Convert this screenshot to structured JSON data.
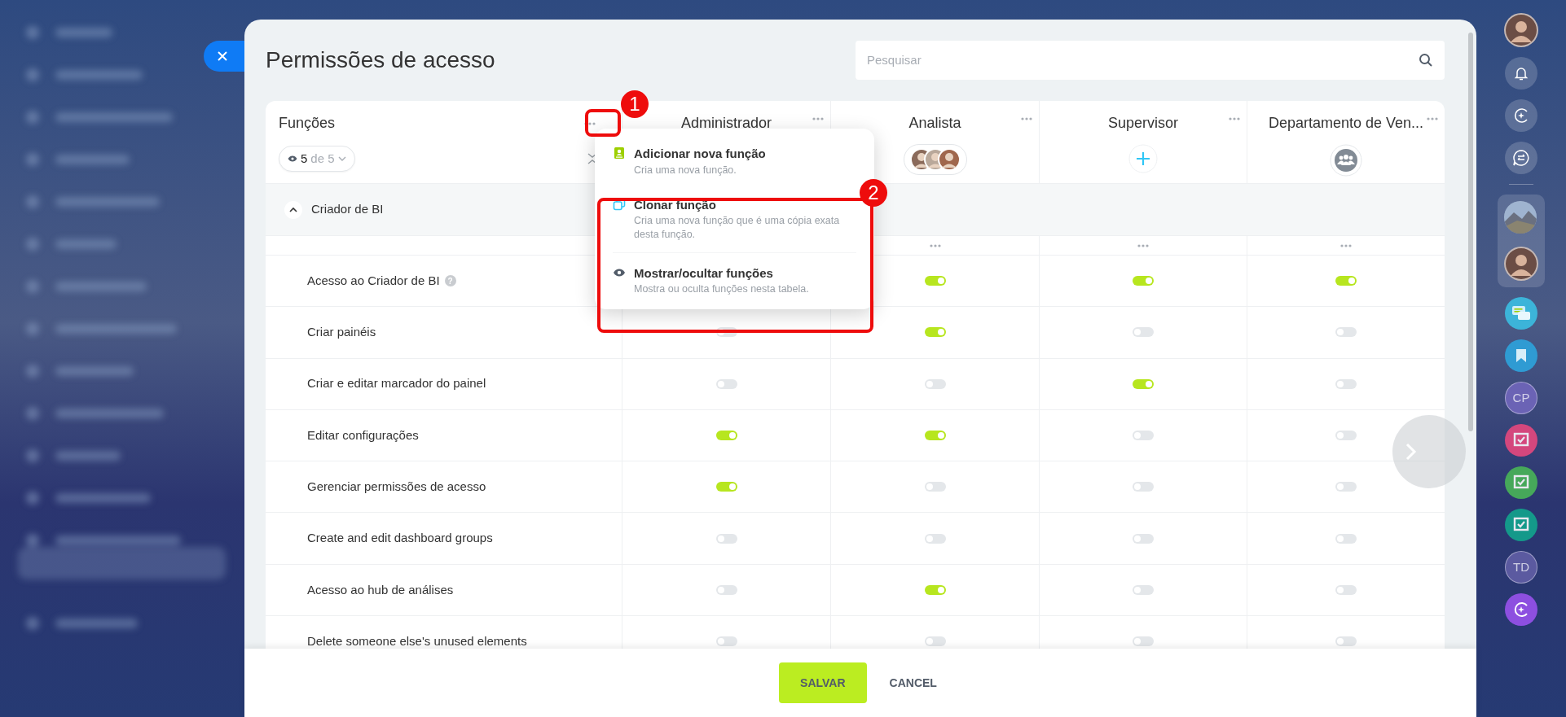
{
  "title": "Permissões de acesso",
  "search": {
    "placeholder": "Pesquisar"
  },
  "roles_header": {
    "label": "Funções",
    "visible_count": "5",
    "visible_total": "de 5"
  },
  "roles": [
    {
      "name": "Administrador"
    },
    {
      "name": "Analista",
      "members": {
        "kind": "avatars"
      }
    },
    {
      "name": "Supervisor",
      "members": {
        "kind": "add"
      }
    },
    {
      "name": "Departamento de Ven...",
      "members": {
        "kind": "department"
      }
    }
  ],
  "sections": [
    {
      "title": "Criador de BI",
      "expanded": true,
      "rows": [
        {
          "label": "Acesso ao Criador de BI",
          "help": "?",
          "toggles": [
            true,
            true,
            true
          ]
        },
        {
          "label": "Criar painéis",
          "toggles": [
            false,
            true,
            false,
            false
          ]
        },
        {
          "label": "Criar e editar marcador do painel",
          "toggles": [
            false,
            false,
            true,
            false
          ]
        },
        {
          "label": "Editar configurações",
          "toggles": [
            true,
            true,
            false,
            false
          ]
        },
        {
          "label": "Gerenciar permissões de acesso",
          "toggles": [
            true,
            false,
            false,
            false
          ]
        },
        {
          "label": "Create and edit dashboard groups",
          "toggles": [
            false,
            false,
            false,
            false
          ]
        },
        {
          "label": "Acesso ao hub de análises",
          "toggles": [
            false,
            true,
            false,
            false
          ]
        },
        {
          "label": "Delete someone else's unused elements",
          "toggles": [
            false,
            false,
            false,
            false
          ]
        }
      ]
    }
  ],
  "menu": {
    "items": [
      {
        "kind": "add",
        "title": "Adicionar nova função",
        "description": "Cria uma nova função."
      },
      {
        "kind": "clone",
        "title": "Clonar função",
        "description": "Cria uma nova função que é uma cópia exata desta função."
      },
      {
        "kind": "visibility",
        "title": "Mostrar/ocultar funções",
        "description": "Mostra ou oculta funções nesta tabela."
      }
    ]
  },
  "annotations": [
    {
      "label": "1"
    },
    {
      "label": "2"
    }
  ],
  "footer": {
    "save": "SALVAR",
    "cancel": "CANCEL"
  },
  "right_sidebar": [
    {
      "kind": "avatar",
      "pinned": false
    },
    {
      "kind": "bell",
      "pinned": false
    },
    {
      "kind": "ring",
      "pinned": false
    },
    {
      "kind": "swap",
      "pinned": false
    },
    {
      "kind": "divider"
    },
    {
      "kind": "landscape",
      "pinned": true
    },
    {
      "kind": "avatar",
      "pinned": true
    },
    {
      "kind": "chat",
      "pinned": false,
      "color": "#3cb4d9"
    },
    {
      "kind": "bookmark",
      "pinned": false,
      "color": "#2f9bd3"
    },
    {
      "kind": "initials",
      "text": "CP",
      "pinned": false,
      "color": "#6b63b5"
    },
    {
      "kind": "task",
      "pinned": false,
      "color": "#d4477d"
    },
    {
      "kind": "task",
      "pinned": false,
      "color": "#46a85a"
    },
    {
      "kind": "task",
      "pinned": false,
      "color": "#14998a"
    },
    {
      "kind": "initials",
      "text": "TD",
      "pinned": false,
      "color": "#5b5aa0"
    },
    {
      "kind": "copilot",
      "pinned": false,
      "color": "#8d4fe0"
    }
  ]
}
